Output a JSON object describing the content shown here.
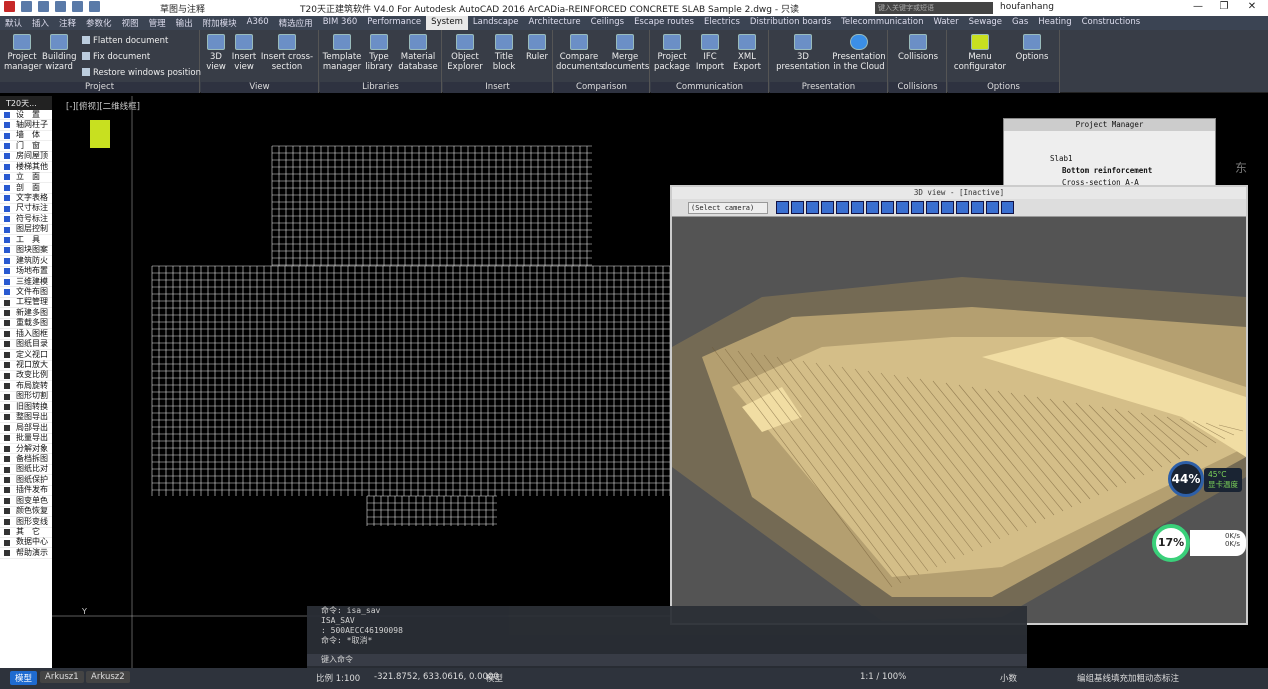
{
  "window": {
    "title": "T20天正建筑软件 V4.0 For Autodesk AutoCAD 2016    ArCADia-REINFORCED CONCRETE SLAB Sample 2.dwg - 只读",
    "workspace": "草图与注释",
    "search_placeholder": "键入关键字或短语",
    "user": "houfanhang",
    "min": "—",
    "max": "❐",
    "close": "✕"
  },
  "tabs": [
    "默认",
    "插入",
    "注释",
    "参数化",
    "视图",
    "管理",
    "输出",
    "附加模块",
    "A360",
    "精选应用",
    "BIM 360",
    "Performance",
    "System",
    "Landscape",
    "Architecture",
    "Ceilings",
    "Escape routes",
    "Electrics",
    "Distribution boards",
    "Telecommunication",
    "Water",
    "Sewage",
    "Gas",
    "Heating",
    "Constructions"
  ],
  "active_tab": "System",
  "ribbon": {
    "project": {
      "title": "Project",
      "btn1": "Project manager",
      "btn2": "Building wizard",
      "s1": "Flatten document",
      "s2": "Fix document",
      "s3": "Restore windows position"
    },
    "view": {
      "title": "View",
      "btn1": "3D view",
      "btn2": "Insert view",
      "btn3": "Insert cross-section"
    },
    "libraries": {
      "title": "Libraries",
      "btn1": "Template manager",
      "btn2": "Type library",
      "btn3": "Material database"
    },
    "insert": {
      "title": "Insert",
      "btn1": "Object Explorer",
      "btn2": "Title block",
      "btn3": "Ruler"
    },
    "comparison": {
      "title": "Comparison",
      "btn1": "Compare documents",
      "btn2": "Merge documents"
    },
    "communication": {
      "title": "Communication",
      "btn1": "Project package",
      "btn2": "IFC Import",
      "btn3": "XML Export"
    },
    "presentation": {
      "title": "Presentation",
      "btn1": "3D presentation",
      "btn2": "Presentation in the Cloud"
    },
    "collisions": {
      "title": "Collisions",
      "btn1": "Collisions"
    },
    "options": {
      "title": "Options",
      "btn1": "Menu configurator",
      "btn2": "Options"
    }
  },
  "side_header": "T20天...",
  "side_items": [
    "设　置",
    "轴网柱子",
    "墙　体",
    "门　窗",
    "房间屋顶",
    "楼梯其他",
    "立　面",
    "剖　面",
    "文字表格",
    "尺寸标注",
    "符号标注",
    "图层控制",
    "工　具",
    "图块图案",
    "建筑防火",
    "场地布置",
    "三维建模",
    "文件布图",
    "工程管理",
    "新建多图",
    "重载多图",
    "插入图框",
    "图纸目录",
    "定义视口",
    "视口放大",
    "改变比例",
    "布局旋转",
    "图形切割",
    "旧图转换",
    "整图导出",
    "局部导出",
    "批量导出",
    "分解对象",
    "备档拆图",
    "图纸比对",
    "图纸保护",
    "插件发布",
    "图变单色",
    "颜色恢复",
    "图形变线",
    "其　它",
    "数据中心",
    "帮助演示"
  ],
  "drawing_title": "[-][俯视][二维线框]",
  "project_manager": {
    "title": "Project Manager",
    "r1": "Slab1",
    "r2": "Bottom reinforcement",
    "r3": "Cross-section A-A"
  },
  "view3d": {
    "title": "3D view - [Inactive]",
    "camera": "(Select camera)"
  },
  "cmd": {
    "l1": "命令: isa_sav",
    "l2": "ISA_SAV",
    "l3": ": 500AECC46190098",
    "l4": "命令: *取消*",
    "prompt": "键入命令"
  },
  "layouts": [
    "模型",
    "Arkusz1",
    "Arkusz2"
  ],
  "status": {
    "scale": "比例 1:100",
    "coords": "-321.8752, 633.0616, 0.0000",
    "model": "模型",
    "zoom": "1:1 / 100%",
    "units": "小数",
    "right": "编组基线填充加粗动态标注"
  },
  "gauges": {
    "cpu": "44%",
    "temp": "45°C",
    "label": "显卡温度",
    "mem": "17%",
    "up": "0K/s",
    "down": "0K/s"
  },
  "colors": {
    "ribbon": "#383d47",
    "tabbar": "#3b4453",
    "active_status": "#1f6bd0"
  }
}
